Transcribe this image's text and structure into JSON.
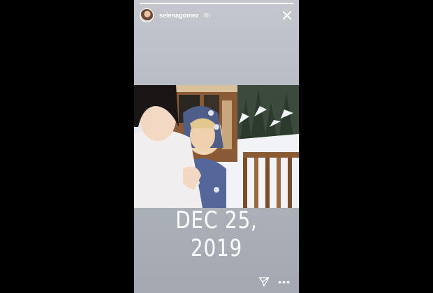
{
  "story": {
    "username": "selenagomez",
    "time": "8h",
    "progress_fraction": 1.0,
    "date_text": "DEC 25, 2019",
    "icons": [
      "avatar",
      "close-icon",
      "send-icon",
      "more-icon"
    ]
  },
  "footer": {
    "more_label": "•••"
  },
  "colors": {
    "background": "#000000",
    "story_bg": "#b0b5bc",
    "text": "#ffffff"
  }
}
